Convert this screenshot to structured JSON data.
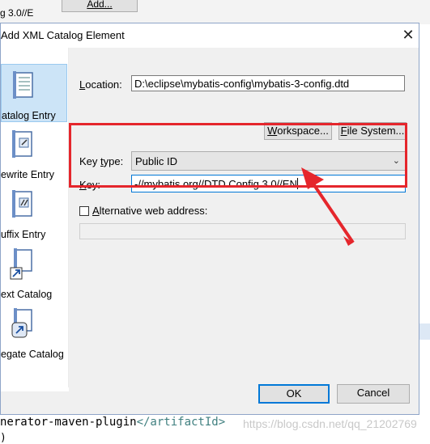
{
  "background": {
    "top_left_text": "g 3.0//E",
    "top_button": "Add...",
    "code_line_start": "nerator-maven-plugin",
    "code_line_tag": "</artifactId>",
    "watermark": "https://blog.csdn.net/qq_21202769",
    "bottom_line": ")"
  },
  "dialog": {
    "title": "Add XML Catalog Element",
    "close_label": "✕"
  },
  "sidebar": {
    "items": [
      {
        "label": "atalog Entry",
        "icon": "catalog-entry-icon"
      },
      {
        "label": "ewrite Entry",
        "icon": "rewrite-entry-icon"
      },
      {
        "label": "uffix Entry",
        "icon": "suffix-entry-icon"
      },
      {
        "label": "ext Catalog",
        "icon": "next-catalog-icon"
      },
      {
        "label": "egate Catalog",
        "icon": "delegate-catalog-icon"
      }
    ]
  },
  "form": {
    "location_label_prefix": "L",
    "location_label_rest": "ocation:",
    "location_value": "D:\\eclipse\\mybatis-config\\mybatis-3-config.dtd",
    "workspace_btn_u": "W",
    "workspace_btn_rest": "orkspace...",
    "filesystem_btn_u": "F",
    "filesystem_btn_rest": "ile System...",
    "key_type_label_pre": "Key ",
    "key_type_label_u": "t",
    "key_type_label_post": "ype:",
    "key_type_value": "Public ID",
    "key_label_u": "K",
    "key_label_rest": "ey:",
    "key_value": "-//mybatis.org//DTD Config 3.0//EN",
    "alt_label_u": "A",
    "alt_label_rest": "lternative web address:",
    "alt_value": ""
  },
  "footer": {
    "ok": "OK",
    "cancel": "Cancel"
  },
  "colors": {
    "annotation_red": "#e5262c",
    "selection_blue": "#cce4f7",
    "focus_blue": "#0078d7"
  }
}
